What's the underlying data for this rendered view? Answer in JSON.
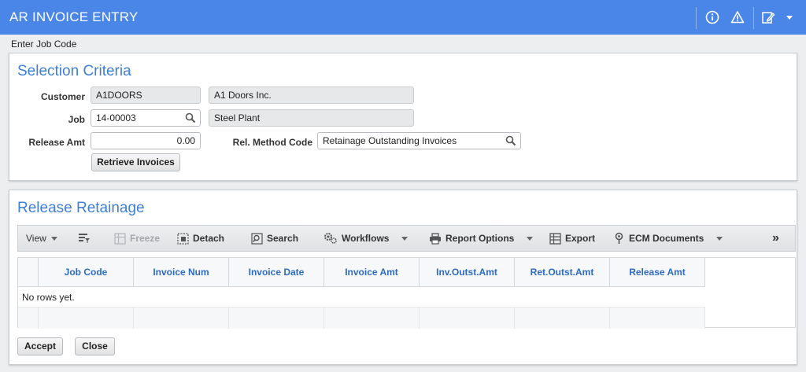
{
  "header": {
    "title": "AR INVOICE ENTRY",
    "icons": [
      "info-icon",
      "warning-icon",
      "edit-icon",
      "caret-down-icon"
    ]
  },
  "subtitle": "Enter Job Code",
  "selection": {
    "title": "Selection Criteria",
    "customer_label": "Customer",
    "customer_code": "A1DOORS",
    "customer_name": "A1 Doors Inc.",
    "job_label": "Job",
    "job_value": "14-00003",
    "job_name": "Steel Plant",
    "release_amt_label": "Release Amt",
    "release_amt_value": "0.00",
    "rel_method_label": "Rel. Method Code",
    "rel_method_value": "Retainage Outstanding Invoices",
    "retrieve_button": "Retrieve Invoices"
  },
  "release": {
    "title": "Release Retainage",
    "toolbar": {
      "view": "View",
      "freeze": "Freeze",
      "detach": "Detach",
      "search": "Search",
      "workflows": "Workflows",
      "report_options": "Report Options",
      "export": "Export",
      "ecm_documents": "ECM Documents",
      "more": "»"
    },
    "columns": [
      "Job Code",
      "Invoice Num",
      "Invoice Date",
      "Invoice Amt",
      "Inv.Outst.Amt",
      "Ret.Outst.Amt",
      "Release Amt"
    ],
    "empty_message": "No rows yet.",
    "accept_button": "Accept",
    "close_button": "Close"
  },
  "colors": {
    "header_bg": "#4a86e8",
    "panel_title": "#3d7fd6",
    "column_header_text": "#2d6bc2"
  }
}
